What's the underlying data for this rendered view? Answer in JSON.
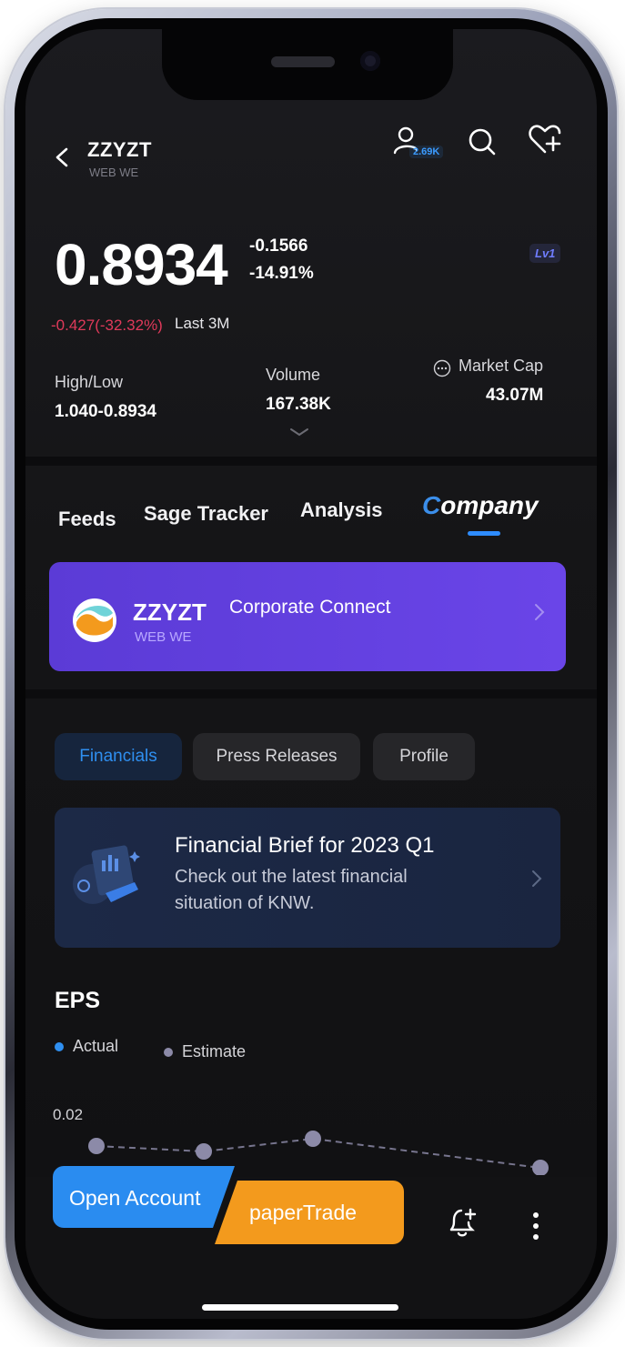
{
  "header": {
    "ticker": "ZZYZT",
    "exchange": "WEB WE",
    "followers": "2.69K"
  },
  "quote": {
    "price": "0.8934",
    "change": "-0.1566",
    "change_pct": "-14.91%",
    "level": "Lv1",
    "period_change": "-0.427(-32.32%)",
    "period_label": "Last 3M",
    "high_low_label": "High/Low",
    "high_low_value": "1.040-0.8934",
    "volume_label": "Volume",
    "volume_value": "167.38K",
    "market_cap_label": "Market Cap",
    "market_cap_value": "43.07M"
  },
  "tabs": {
    "feeds": "Feeds",
    "sage": "Sage Tracker",
    "analysis": "Analysis",
    "company_cap": "C",
    "company_rest": "ompany"
  },
  "corporate_connect": {
    "ticker": "ZZYZT",
    "exchange": "WEB WE",
    "title": "Corporate Connect"
  },
  "subtabs": {
    "financials": "Financials",
    "press": "Press Releases",
    "profile": "Profile"
  },
  "brief": {
    "title": "Financial Brief for 2023 Q1",
    "body": "Check out the latest financial situation of KNW."
  },
  "eps": {
    "title": "EPS",
    "legend_actual": "Actual",
    "legend_estimate": "Estimate",
    "y_tick": "0.02"
  },
  "bottom": {
    "open_account": "Open Account",
    "paper_trade": "paperTrade"
  },
  "colors": {
    "accent_blue": "#2f8ff0",
    "negative_red": "#e03a5a",
    "purple_card": "#6a45e8",
    "orange_button": "#f39a1d"
  }
}
